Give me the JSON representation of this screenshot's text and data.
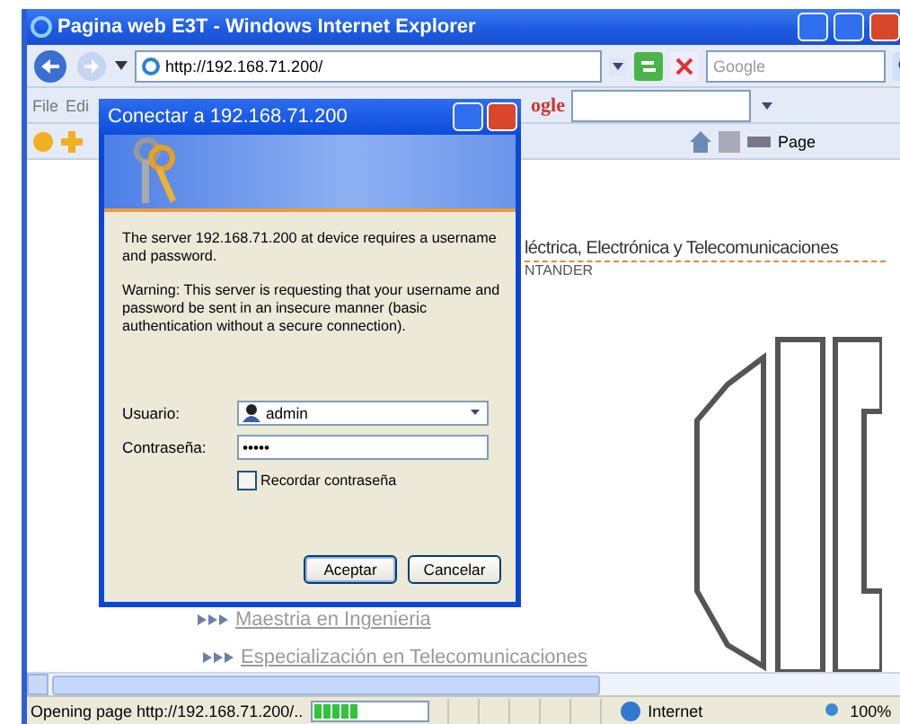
{
  "browser": {
    "title": "Pagina web E3T - Windows Internet Explorer",
    "address": "http://192.168.71.200/",
    "search_placeholder": "Google",
    "menu": [
      "File",
      "Edi"
    ],
    "toolbar_logo": "ogle",
    "page_menu": "Page",
    "content": {
      "heading": "léctrica, Electrónica y Telecomunicaciones",
      "subheading": "NTANDER",
      "links": [
        "Maestria en Ingenieria",
        "Especialización en Telecomunicaciones"
      ]
    },
    "status_bar": {
      "text": "Opening page http://192.168.71.200/..",
      "progress": {
        "level": 0.4
      },
      "zone": "Internet",
      "zoom": "100%"
    }
  },
  "dialog": {
    "title": "Conectar a 192.168.71.200",
    "message": "The server 192.168.71.200 at device requires a username and password.",
    "warning": "Warning: This server is requesting that your username and password be sent in an insecure manner (basic authentication without a secure connection).",
    "fields": [
      {
        "label": "Usuario:",
        "kind": "combo",
        "value": "admin"
      },
      {
        "label": "Contraseña:",
        "kind": "password",
        "value": "•••••"
      }
    ],
    "remember": {
      "label": "Recordar contraseña",
      "checked": false
    },
    "buttons": [
      "Aceptar",
      "Cancelar"
    ]
  }
}
